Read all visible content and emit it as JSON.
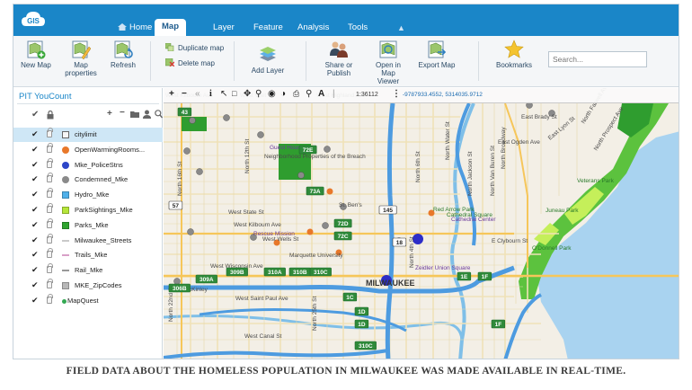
{
  "app": {
    "logo_text": "GIS"
  },
  "tabs": [
    {
      "label": "Home"
    },
    {
      "label": "Map"
    },
    {
      "label": "Layer"
    },
    {
      "label": "Feature"
    },
    {
      "label": "Analysis"
    },
    {
      "label": "Tools"
    }
  ],
  "ribbon": {
    "new_map": "New Map",
    "map_properties": [
      "Map",
      "properties"
    ],
    "refresh": "Refresh",
    "duplicate_map": "Duplicate map",
    "delete_map": "Delete map",
    "add_layer": "Add Layer",
    "share_or_publish": [
      "Share or",
      "Publish"
    ],
    "open_in_map_viewer": [
      "Open in",
      "Map Viewer"
    ],
    "export_map": "Export Map",
    "bookmarks": "Bookmarks",
    "search_placeholder": "Search..."
  },
  "panel": {
    "title": "PIT YouCount",
    "layers": [
      {
        "name": "citylimit",
        "symbol": "square-outline",
        "selected": true
      },
      {
        "name": "OpenWarmingRooms...",
        "symbol": "circle",
        "color": "#e8782a"
      },
      {
        "name": "Mke_PoliceStns",
        "symbol": "circle",
        "color": "#2d46c8"
      },
      {
        "name": "Condemned_Mke",
        "symbol": "circle",
        "color": "#8a8a8a"
      },
      {
        "name": "Hydro_Mke",
        "symbol": "square",
        "color": "#4fb0ea"
      },
      {
        "name": "ParkSightings_Mke",
        "symbol": "square",
        "color": "#b6e63a"
      },
      {
        "name": "Parks_Mke",
        "symbol": "square",
        "color": "#2fa52f"
      },
      {
        "name": "Milwaukee_Streets",
        "symbol": "line",
        "color": "#c9c9c9"
      },
      {
        "name": "Trails_Mke",
        "symbol": "line",
        "color": "#d8a0c8"
      },
      {
        "name": "Rail_Mke",
        "symbol": "line",
        "color": "#999999"
      },
      {
        "name": "MKE_ZipCodes",
        "symbol": "square",
        "color": "#b8b8b8"
      },
      {
        "name": "MapQuest",
        "symbol": "dot",
        "color": "#33a852"
      }
    ]
  },
  "map": {
    "scale": "1:36112",
    "coords": "-9787933.4552, 5314035.9712",
    "labels": [
      "West Kilbourn Ave",
      "West Vliet St",
      "West Highland Ave",
      "Guest House",
      "Neighborhood Properties of the Breach",
      "St. Ben's",
      "West State St",
      "West Wells St",
      "Rescue Mission",
      "West Kilbourn Ave",
      "Marquette University",
      "West Wisconsin Ave",
      "West Saint Paul Ave",
      "West Canal St",
      "North 25th St",
      "MILWAUKEE",
      "Zeidler Union Square",
      "Red Arrow Park",
      "Cathedral Center",
      "Cathedral Square",
      "O'Donnell Park",
      "Juneau Park",
      "Veterans Park",
      "North Prospect Ave",
      "North Farwell Ave",
      "East Brady St",
      "East Ogden Ave",
      "North Water St",
      "North Van Buren St",
      "East Lyon St",
      "North 6th St",
      "North 12th St",
      "North 16th St",
      "North 4th St",
      "North 22nd St",
      "West McKinley",
      "North Jackson St",
      "North Broadway",
      "E Clybourn St"
    ],
    "shields": [
      "43",
      "72E",
      "73A",
      "145",
      "72D",
      "72C",
      "309B",
      "310A",
      "310B",
      "310C",
      "1E",
      "1F",
      "1F",
      "1D",
      "1D",
      "1C",
      "310C",
      "57",
      "18",
      "306B",
      "309A"
    ]
  },
  "caption": "FIELD DATA ABOUT THE HOMELESS POPULATION IN MILWAUKEE WAS MADE AVAILABLE IN REAL-TIME.",
  "colors": {
    "topbar": "#1a86c8",
    "water": "#a9d3f0",
    "park": "#3aa83a",
    "freeway": "#4d9be0",
    "police_marker": "#2d2dc8"
  }
}
